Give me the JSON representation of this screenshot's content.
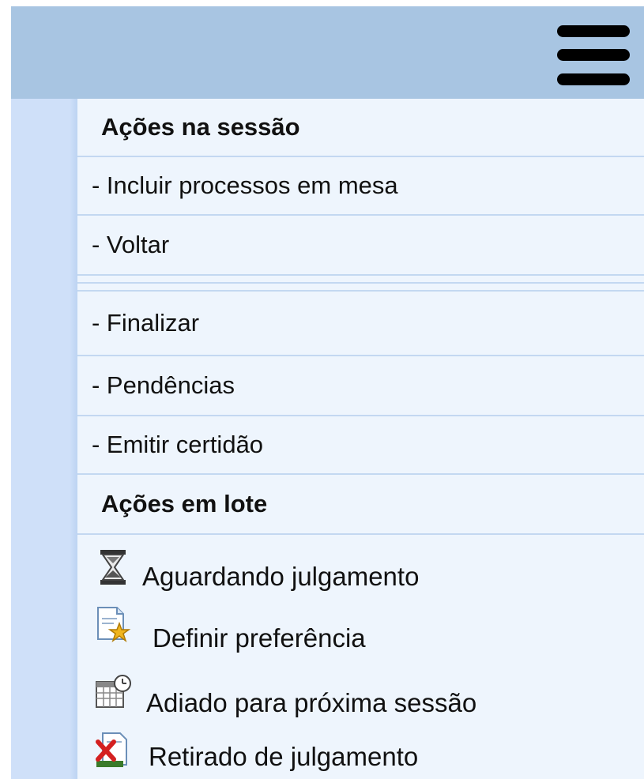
{
  "header": {
    "menu_icon": "hamburger-menu-icon",
    "bar_color": "#a8c5e2"
  },
  "session_actions": {
    "title": "Ações na sessão",
    "items": [
      "- Incluir processos em mesa",
      "- Voltar",
      "- Finalizar",
      "- Pendências",
      "- Emitir certidão"
    ]
  },
  "batch_actions": {
    "title": "Ações em lote",
    "items": [
      {
        "label": "Aguardando julgamento",
        "icon": "hourglass-icon"
      },
      {
        "label": "Definir preferência",
        "icon": "document-star-icon"
      },
      {
        "label": "Adiado para próxima sessão",
        "icon": "calendar-clock-icon"
      },
      {
        "label": "Retirado de julgamento",
        "icon": "document-remove-icon"
      }
    ]
  },
  "colors": {
    "menu_bg": "#eef5fd",
    "separator": "#c3d8f1",
    "left_strip": "#cfe0f9"
  }
}
